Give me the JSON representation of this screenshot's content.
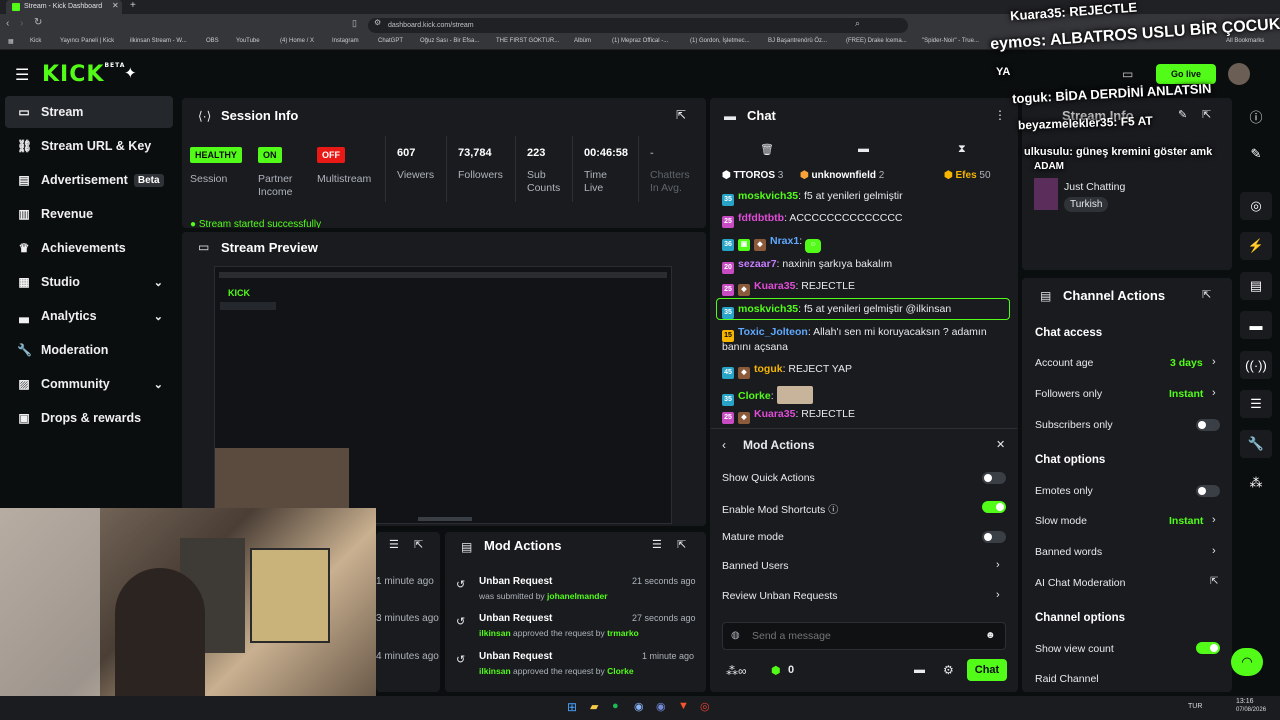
{
  "browser": {
    "tab_title": "Stream - Kick Dashboard",
    "url": "dashboard.kick.com/stream",
    "bookmarks": [
      "Kick",
      "Yayıncı Paneli | Kick",
      "ilkinsan Stream - W...",
      "OBS",
      "YouTube",
      "(4) Home / X",
      "Instagram",
      "ChatGPT",
      "Oğuz Sası - Bir Efsa...",
      "THE FIRST GOKTUR...",
      "Albüm",
      "(1) Mepraz Offical -...",
      "(1) Gordon, İşletmec...",
      "BJ Başantrenörü Öz...",
      "(FREE) Drake Icema...",
      "\"Spider-Noir\" - True...",
      "All Bookmarks"
    ]
  },
  "brand": {
    "logo": "KICK",
    "beta": "BETA",
    "accent": "#53fc18"
  },
  "sidebar": {
    "items": [
      {
        "label": "Stream",
        "icon": "stream-icon"
      },
      {
        "label": "Stream URL & Key",
        "icon": "link-icon"
      },
      {
        "label": "Advertisement",
        "icon": "ad-icon",
        "badge": "Beta"
      },
      {
        "label": "Revenue",
        "icon": "revenue-icon"
      },
      {
        "label": "Achievements",
        "icon": "trophy-icon"
      },
      {
        "label": "Studio",
        "icon": "studio-icon"
      },
      {
        "label": "Analytics",
        "icon": "analytics-icon"
      },
      {
        "label": "Moderation",
        "icon": "wrench-icon"
      },
      {
        "label": "Community",
        "icon": "community-icon"
      },
      {
        "label": "Drops & rewards",
        "icon": "gift-icon"
      }
    ]
  },
  "session": {
    "title": "Session Info",
    "stats": [
      {
        "value": "HEALTHY",
        "label": "Session"
      },
      {
        "value": "ON",
        "label": "Partner Income"
      },
      {
        "value": "OFF",
        "label": "Multistream"
      },
      {
        "value": "607",
        "label": "Viewers"
      },
      {
        "value": "73,784",
        "label": "Followers"
      },
      {
        "value": "223",
        "label": "Sub Counts"
      },
      {
        "value": "00:46:58",
        "label": "Time Live"
      },
      {
        "value": "-",
        "label": "Chatters In Avg."
      }
    ],
    "notice": "Stream started successfully"
  },
  "preview": {
    "title": "Stream Preview"
  },
  "mod_actions_panel": {
    "title": "Mod Actions",
    "items": [
      {
        "action": "Unban Request",
        "time": "21 seconds ago",
        "pre": "was submitted by",
        "user": "johanelmander",
        "post": ""
      },
      {
        "action": "Unban Request",
        "time": "27 seconds ago",
        "pre": "",
        "user": "ilkinsan",
        "post": "approved the request by",
        "target": "trmarko"
      },
      {
        "action": "Unban Request",
        "time": "1 minute ago",
        "pre": "",
        "user": "ilkinsan",
        "post": "approved the request by",
        "target": "Clorke"
      }
    ],
    "left_times": [
      "1 minute ago",
      "3 minutes ago",
      "4 minutes ago"
    ]
  },
  "chat": {
    "title": "Chat",
    "leaders": [
      {
        "name": "TTOROS",
        "count": "3"
      },
      {
        "name": "unknownfield",
        "count": "2"
      },
      {
        "name": "Efes",
        "count": "50"
      }
    ],
    "messages": [
      {
        "user": "moskvich35",
        "color": "#53fc18",
        "text": "f5 at yenileri gelmiştir"
      },
      {
        "user": "fdfdbtbtb",
        "color": "#e04dd6",
        "text": "ACCCCCCCCCCCCCC"
      },
      {
        "user": "Nrax1",
        "color": "#5fa9ff",
        "text": ""
      },
      {
        "user": "sezaar7",
        "color": "#c77dff",
        "text": "naxinin şarkıya bakalım"
      },
      {
        "user": "Kuara35",
        "color": "#e04dd6",
        "text": "REJECTLE"
      },
      {
        "user": "moskvich35",
        "color": "#53fc18",
        "text": "f5 at yenileri gelmiştir @ilkinsan"
      },
      {
        "user": "Toxic_Jolteon",
        "color": "#5fa9ff",
        "text": "Allah'ı sen mi koruyacaksın ? adamın"
      },
      {
        "user": "",
        "color": "#fff",
        "text": "banını açsana"
      },
      {
        "user": "toguk",
        "color": "#f7b500",
        "text": "REJECT YAP"
      },
      {
        "user": "Clorke",
        "color": "#53fc18",
        "text": ""
      },
      {
        "user": "Kuara35",
        "color": "#e04dd6",
        "text": "REJECTLE"
      }
    ],
    "mod_menu": {
      "title": "Mod Actions",
      "show_quick": "Show Quick Actions",
      "enable_shortcuts": "Enable Mod Shortcuts",
      "mature": "Mature mode",
      "banned": "Banned Users",
      "review": "Review Unban Requests"
    },
    "input_placeholder": "Send a message",
    "points": "0",
    "send_label": "Chat"
  },
  "stream_info": {
    "title": "Stream Info",
    "category": "Just Chatting",
    "language": "Turkish"
  },
  "channel_actions": {
    "title": "Channel Actions",
    "chat_access": "Chat access",
    "account_age": "Account age",
    "account_age_val": "3 days",
    "followers_only": "Followers only",
    "followers_only_val": "Instant",
    "subscribers_only": "Subscribers only",
    "chat_options": "Chat options",
    "emotes_only": "Emotes only",
    "slow_mode": "Slow mode",
    "slow_mode_val": "Instant",
    "banned_words": "Banned words",
    "ai_mod": "AI Chat Moderation",
    "channel_options": "Channel options",
    "show_view_count": "Show view count",
    "raid_channel": "Raid Channel"
  },
  "overlay": {
    "lines": [
      "Kuara35: REJECTLE",
      "eymos: ALBATROS USLU BİR ÇOCUK",
      "YA",
      "toguk: BİDA DERDİNİ ANLATSIN",
      "beyazmelekler35: F5 AT",
      "ulkusulu: güneş kremini göster amk",
      "ADAM"
    ],
    "go_live": "Go live"
  },
  "taskbar": {
    "lang": "TUR",
    "time": "13:16",
    "date": "07/08/2026"
  }
}
